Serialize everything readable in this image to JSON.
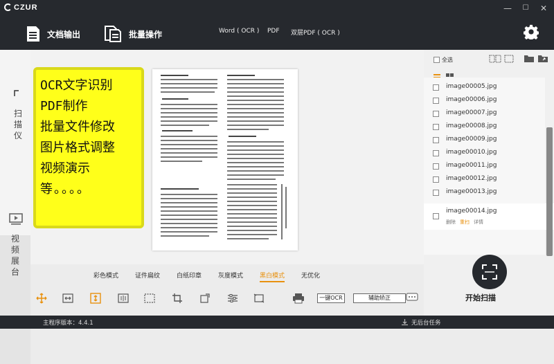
{
  "app": {
    "brand": "CZUR"
  },
  "window": {
    "minimize": "—",
    "maximize": "☐",
    "close": "✕"
  },
  "toolbar": {
    "doc_output": "文档输出",
    "batch": "批量操作",
    "formats": [
      "Word ( OCR )",
      "PDF",
      "双层PDF ( OCR )"
    ]
  },
  "left": {
    "scanner_label": "扫描仪",
    "video_label": "视频展台"
  },
  "banner": {
    "lines": [
      "OCR文字识别",
      "PDF制作",
      "批量文件修改",
      "图片格式调整",
      "视频演示",
      "等。。。。"
    ]
  },
  "modes": [
    {
      "label": "彩色模式",
      "active": false
    },
    {
      "label": "证件扁纹",
      "active": false
    },
    {
      "label": "白纸印章",
      "active": false
    },
    {
      "label": "灰度模式",
      "active": false
    },
    {
      "label": "黑白模式",
      "active": true
    },
    {
      "label": "无优化",
      "active": false
    }
  ],
  "tools": {
    "ocr": "一键OCR",
    "correct": "辅助矫正"
  },
  "panel": {
    "select_all": "全选",
    "files": [
      "image00005.jpg",
      "image00006.jpg",
      "image00007.jpg",
      "image00008.jpg",
      "image00009.jpg",
      "image00010.jpg",
      "image00011.jpg",
      "image00012.jpg",
      "image00013.jpg"
    ],
    "selected": {
      "name": "image00014.jpg",
      "actions": [
        "删除",
        "重扫",
        "详情"
      ]
    },
    "scan_label": "开始扫描"
  },
  "status": {
    "version": "主程序版本：4.4.1",
    "tasks": "无后台任务"
  },
  "colors": {
    "accent": "#e8910f",
    "dark": "#26292e",
    "highlight": "#ffff1a"
  }
}
